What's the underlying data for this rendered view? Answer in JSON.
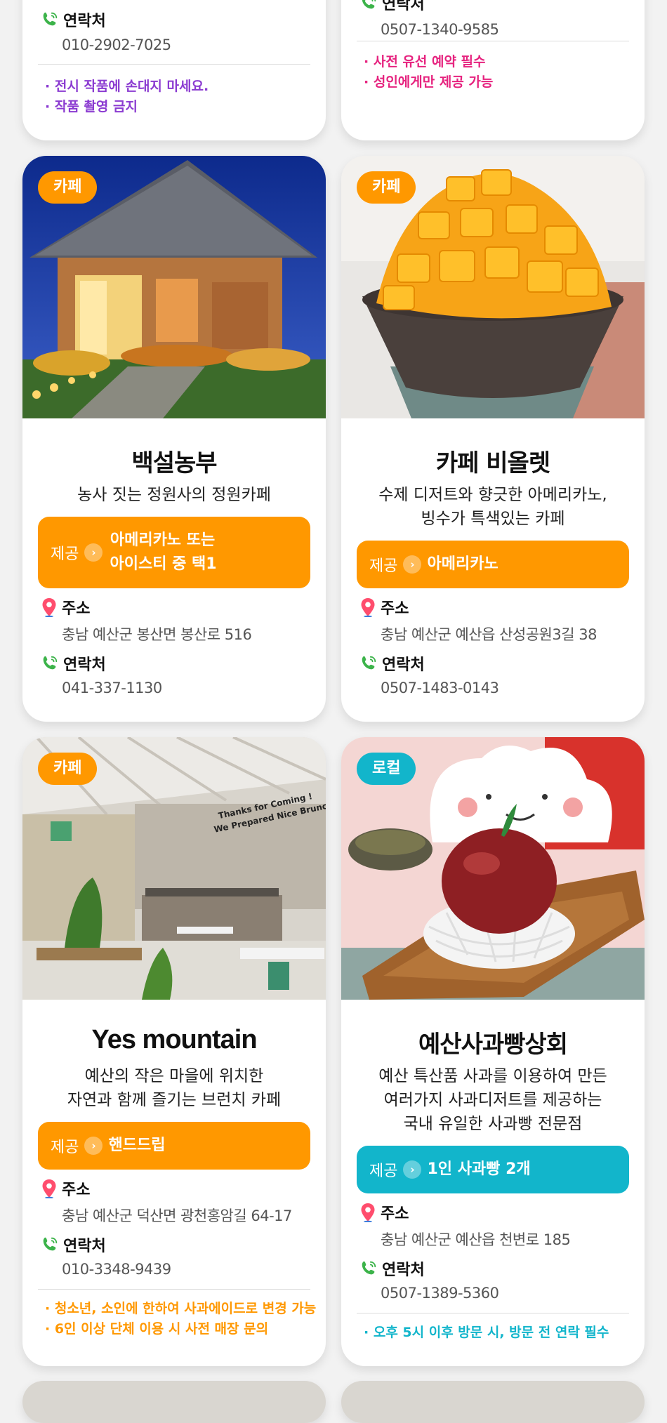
{
  "top_cards": [
    {
      "contact_label": "연락처",
      "contact": "010-2902-7025",
      "notes": [
        "· 전시 작품에 손대지 마세요.",
        "· 작품 촬영 금지"
      ]
    },
    {
      "contact_label": "연락처",
      "contact": "0507-1340-9585",
      "notes": [
        "· 사전 유선 예약 필수",
        "· 성인에게만 제공 가능"
      ]
    }
  ],
  "places": [
    {
      "category": "카페",
      "name": "백설농부",
      "desc_lines": [
        "농사 짓는 정원사의 정원카페"
      ],
      "offer_label": "제공",
      "offer_lines": [
        "아메리카노 또는",
        "아이스티 중 택1"
      ],
      "address_label": "주소",
      "address": "충남 예산군 봉산면 봉산로 516",
      "contact_label": "연락처",
      "contact": "041-337-1130"
    },
    {
      "category": "카페",
      "name": "카페 비올렛",
      "desc_lines": [
        "수제 디저트와 향긋한 아메리카노,",
        "빙수가 특색있는 카페"
      ],
      "offer_label": "제공",
      "offer_lines": [
        "아메리카노"
      ],
      "address_label": "주소",
      "address": "충남 예산군 예산읍 산성공원3길 38",
      "contact_label": "연락처",
      "contact": "0507-1483-0143"
    },
    {
      "category": "카페",
      "name": "Yes mountain",
      "desc_lines": [
        "예산의 작은 마을에 위치한",
        "자연과 함께 즐기는 브런치 카페"
      ],
      "offer_label": "제공",
      "offer_lines": [
        "핸드드립"
      ],
      "address_label": "주소",
      "address": "충남 예산군 덕산면 광천홍암길 64-17",
      "contact_label": "연락처",
      "contact": "010-3348-9439",
      "notes": [
        "· 청소년, 소인에 한하여 사과에이드로 변경 가능",
        "· 6인 이상 단체 이용 시 사전 매장 문의"
      ]
    },
    {
      "category": "로컬",
      "name": "예산사과빵상회",
      "desc_lines": [
        "예산 특산품 사과를 이용하여 만든",
        "여러가지 사과디저트를 제공하는",
        "국내 유일한 사과빵 전문점"
      ],
      "offer_label": "제공",
      "offer_lines": [
        "1인 사과빵 2개"
      ],
      "address_label": "주소",
      "address": "충남 예산군 예산읍 천변로 185",
      "contact_label": "연락처",
      "contact": "0507-1389-5360",
      "notes": [
        "· 오후 5시 이후 방문 시, 방문 전 연락 필수"
      ]
    }
  ],
  "photo_signs": {
    "yes_mountain": [
      "Thanks for Coming !",
      "We Prepared Nice Brunch"
    ]
  },
  "colors": {
    "cafe": "#ff9800",
    "local": "#12b5cb",
    "pin": "#ff4d6d",
    "phone": "#3cb34a"
  }
}
